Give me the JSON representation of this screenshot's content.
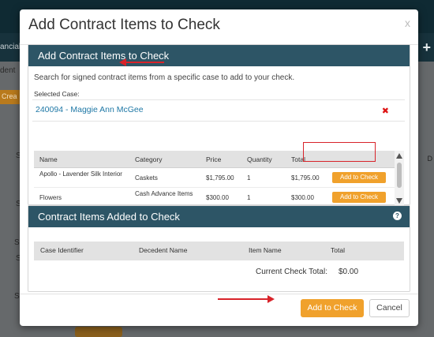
{
  "background": {
    "nav_left": "ancial",
    "side_texts": [
      "dent",
      "Crea",
      "S",
      "S",
      "S",
      "S",
      "S"
    ],
    "right_text": "D"
  },
  "modal": {
    "title": "Add Contract Items to Check",
    "close": "x"
  },
  "panel1": {
    "heading": "Add Contract Items to Check",
    "description": "Search for signed contract items from a specific case to add to your check.",
    "selected_label": "Selected Case:",
    "selected_value": "240094 - Maggie Ann McGee",
    "remove": "✖",
    "columns": [
      "Name",
      "Category",
      "Price",
      "Quantity",
      "Total"
    ],
    "rows": [
      {
        "name": "Apollo - Lavender Silk Interior",
        "category": "Caskets",
        "price": "$1,795.00",
        "quantity": "1",
        "total": "$1,795.00",
        "action": "Add to Check"
      },
      {
        "name": "Flowers",
        "category": "Cash Advance Items",
        "price": "$300.00",
        "quantity": "1",
        "total": "$300.00",
        "action": "Add to Check"
      }
    ]
  },
  "panel2": {
    "heading": "Contract Items Added to Check",
    "help": "?",
    "columns": [
      "Case Identifier",
      "Decedent Name",
      "Item Name",
      "Total"
    ],
    "total_label": "Current Check Total:",
    "total_value": "$0.00"
  },
  "footer": {
    "primary": "Add to Check",
    "cancel": "Cancel"
  },
  "colors": {
    "accent": "#f0a12c",
    "header": "#2d5566",
    "link": "#1f78a6",
    "annotation": "#d8232a"
  }
}
